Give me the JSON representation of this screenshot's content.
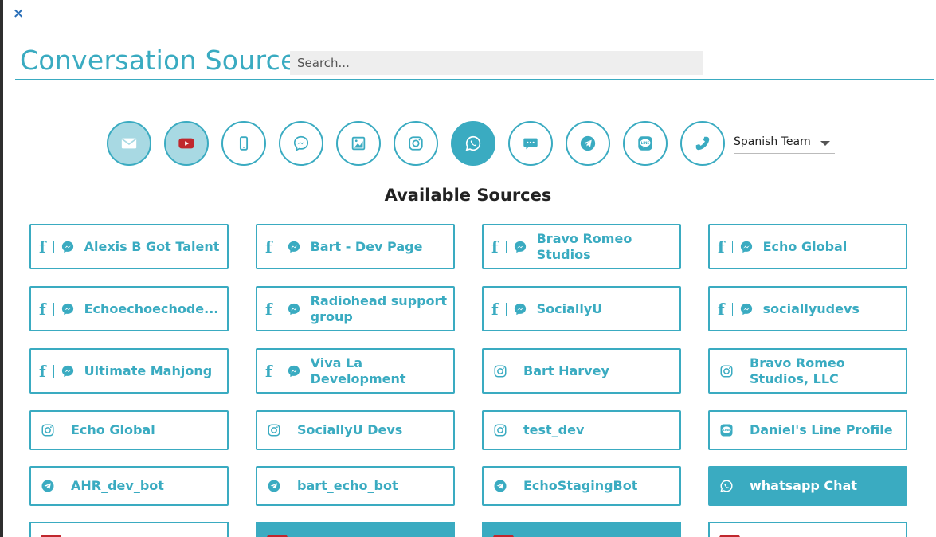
{
  "header": {
    "close_label": "×",
    "title": "Conversation Sources",
    "search_placeholder": "Search..."
  },
  "filters": [
    {
      "name": "email-filter",
      "icon": "envelope-icon",
      "state": "active-light"
    },
    {
      "name": "youtube-filter",
      "icon": "youtube-icon",
      "state": "active-light"
    },
    {
      "name": "sms-filter",
      "icon": "mobile-phone-icon",
      "state": "off"
    },
    {
      "name": "messenger-filter",
      "icon": "messenger-icon",
      "state": "off"
    },
    {
      "name": "image-filter",
      "icon": "image-icon",
      "state": "off"
    },
    {
      "name": "instagram-filter",
      "icon": "instagram-icon",
      "state": "off"
    },
    {
      "name": "whatsapp-filter",
      "icon": "whatsapp-icon",
      "state": "active-dark"
    },
    {
      "name": "chat-filter",
      "icon": "chat-bubble-icon",
      "state": "off"
    },
    {
      "name": "telegram-filter",
      "icon": "telegram-icon",
      "state": "off"
    },
    {
      "name": "line-filter",
      "icon": "line-icon",
      "state": "off"
    },
    {
      "name": "phone-filter",
      "icon": "phone-icon",
      "state": "off"
    }
  ],
  "team_select": {
    "value": "Spanish Team"
  },
  "available_title": "Available Sources",
  "sources": [
    {
      "label": "Alexis B Got Talent",
      "type": "facebook-messenger"
    },
    {
      "label": "Bart - Dev Page",
      "type": "facebook-messenger"
    },
    {
      "label": "Bravo Romeo Studios",
      "type": "facebook-messenger"
    },
    {
      "label": "Echo Global",
      "type": "facebook-messenger"
    },
    {
      "label": "Echoechoechode...",
      "type": "facebook-messenger"
    },
    {
      "label": "Radiohead support group",
      "type": "facebook-messenger"
    },
    {
      "label": "SociallyU",
      "type": "facebook-messenger"
    },
    {
      "label": "sociallyudevs",
      "type": "facebook-messenger"
    },
    {
      "label": "Ultimate Mahjong",
      "type": "facebook-messenger"
    },
    {
      "label": "Viva La Development",
      "type": "facebook-messenger"
    },
    {
      "label": "Bart Harvey",
      "type": "instagram"
    },
    {
      "label": "Bravo Romeo Studios, LLC",
      "type": "instagram"
    },
    {
      "label": "Echo Global",
      "type": "instagram"
    },
    {
      "label": "SociallyU Devs",
      "type": "instagram"
    },
    {
      "label": "test_dev",
      "type": "instagram"
    },
    {
      "label": "Daniel's Line Profile",
      "type": "line"
    },
    {
      "label": "AHR_dev_bot",
      "type": "telegram"
    },
    {
      "label": "bart_echo_bot",
      "type": "telegram"
    },
    {
      "label": "EchoStagingBot",
      "type": "telegram"
    },
    {
      "label": "whatsapp Chat",
      "type": "whatsapp",
      "active": true
    }
  ],
  "colors": {
    "accent": "#3aabc1",
    "accent_light": "#a8d9e3",
    "youtube_red": "#c0272d"
  }
}
